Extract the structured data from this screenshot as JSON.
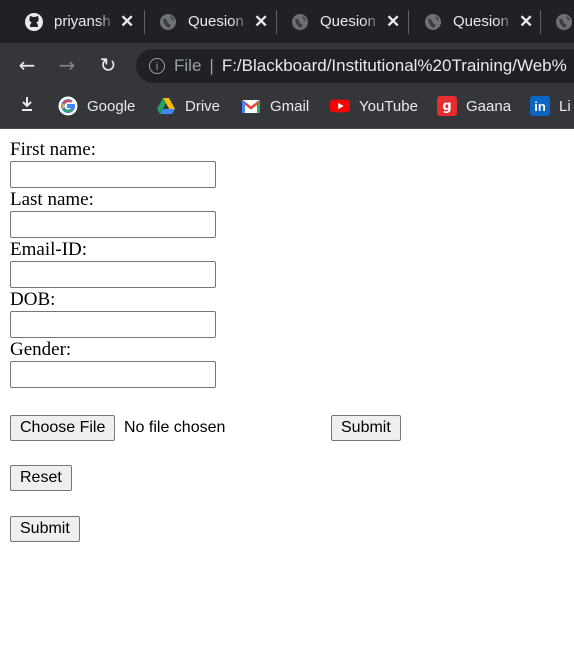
{
  "tabs": [
    {
      "title": "priyansh",
      "icon": "github-icon"
    },
    {
      "title": "Quesion",
      "icon": "globe-icon"
    },
    {
      "title": "Quesion",
      "icon": "globe-icon"
    },
    {
      "title": "Quesion",
      "icon": "globe-icon"
    }
  ],
  "tab_close_glyph": "✕",
  "nav": {
    "back": "←",
    "forward": "→",
    "reload": "↻"
  },
  "omnibox": {
    "scheme": "File",
    "separator": "|",
    "url": "F:/Blackboard/Institutional%20Training/Web%"
  },
  "bookmarks": [
    {
      "label": "Google",
      "icon": "google-icon"
    },
    {
      "label": "Drive",
      "icon": "drive-icon"
    },
    {
      "label": "Gmail",
      "icon": "gmail-icon"
    },
    {
      "label": "YouTube",
      "icon": "youtube-icon"
    },
    {
      "label": "Gaana",
      "icon": "gaana-icon"
    },
    {
      "label": "Li",
      "icon": "linkedin-icon"
    }
  ],
  "form": {
    "first_name_label": "First name:",
    "last_name_label": "Last name:",
    "email_label": "Email-ID:",
    "dob_label": "DOB:",
    "gender_label": "Gender:",
    "first_name_value": "",
    "last_name_value": "",
    "email_value": "",
    "dob_value": "",
    "gender_value": "",
    "choose_file_label": "Choose File",
    "no_file_text": "No file chosen",
    "submit_label_1": "Submit",
    "reset_label": "Reset",
    "submit_label_2": "Submit"
  },
  "colors": {
    "chrome_dark": "#202124",
    "chrome_toolbar": "#35363a",
    "text_light": "#e8eaed"
  }
}
